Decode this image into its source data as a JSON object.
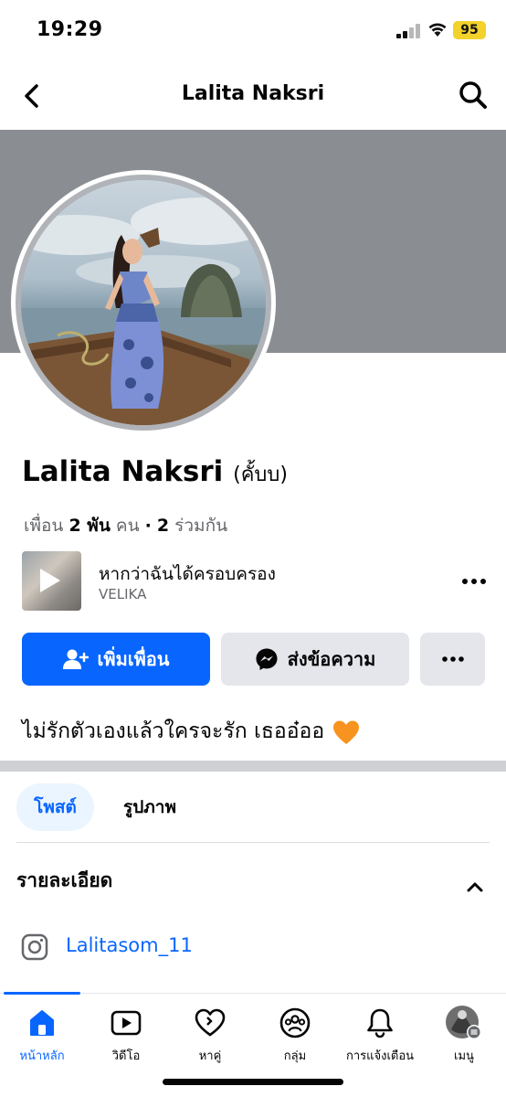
{
  "status_bar": {
    "time": "19:29",
    "battery": "95",
    "battery_color": "#f2d22b"
  },
  "header": {
    "title": "Lalita Naksri",
    "back_icon": "chevron-left-icon",
    "search_icon": "search-icon"
  },
  "profile": {
    "name": "Lalita Naksri",
    "alternate_name": "(คั้บบ)",
    "friends_prefix": "เพื่อน",
    "friends_count": "2 พัน",
    "friends_unit": "คน",
    "separator": "·",
    "mutual_count": "2",
    "mutual_label": "ร่วมกัน",
    "bio": "ไม่รักตัวเองแล้วใครจะรัก เธออ๋ออ",
    "bio_emoji": "orange-heart-icon"
  },
  "music": {
    "title": "หากว่าฉันได้ครอบครอง",
    "artist": "VELIKA"
  },
  "actions": {
    "add_friend_label": "เพิ่มเพื่อน",
    "message_label": "ส่งข้อความ",
    "accent_color": "#0866ff"
  },
  "tabs": [
    {
      "label": "โพสต์",
      "active": true
    },
    {
      "label": "รูปภาพ",
      "active": false
    }
  ],
  "details": {
    "title": "รายละเอียด",
    "instagram_handle": "Lalitasom_11"
  },
  "bottom_nav": [
    {
      "label": "หน้าหลัก",
      "icon": "home-icon",
      "active": true
    },
    {
      "label": "วิดีโอ",
      "icon": "video-icon",
      "active": false
    },
    {
      "label": "หาคู่",
      "icon": "dating-heart-icon",
      "active": false
    },
    {
      "label": "กลุ่ม",
      "icon": "groups-icon",
      "active": false
    },
    {
      "label": "การแจ้งเตือน",
      "icon": "bell-icon",
      "active": false
    },
    {
      "label": "เมนู",
      "icon": "menu-avatar-icon",
      "active": false
    }
  ]
}
